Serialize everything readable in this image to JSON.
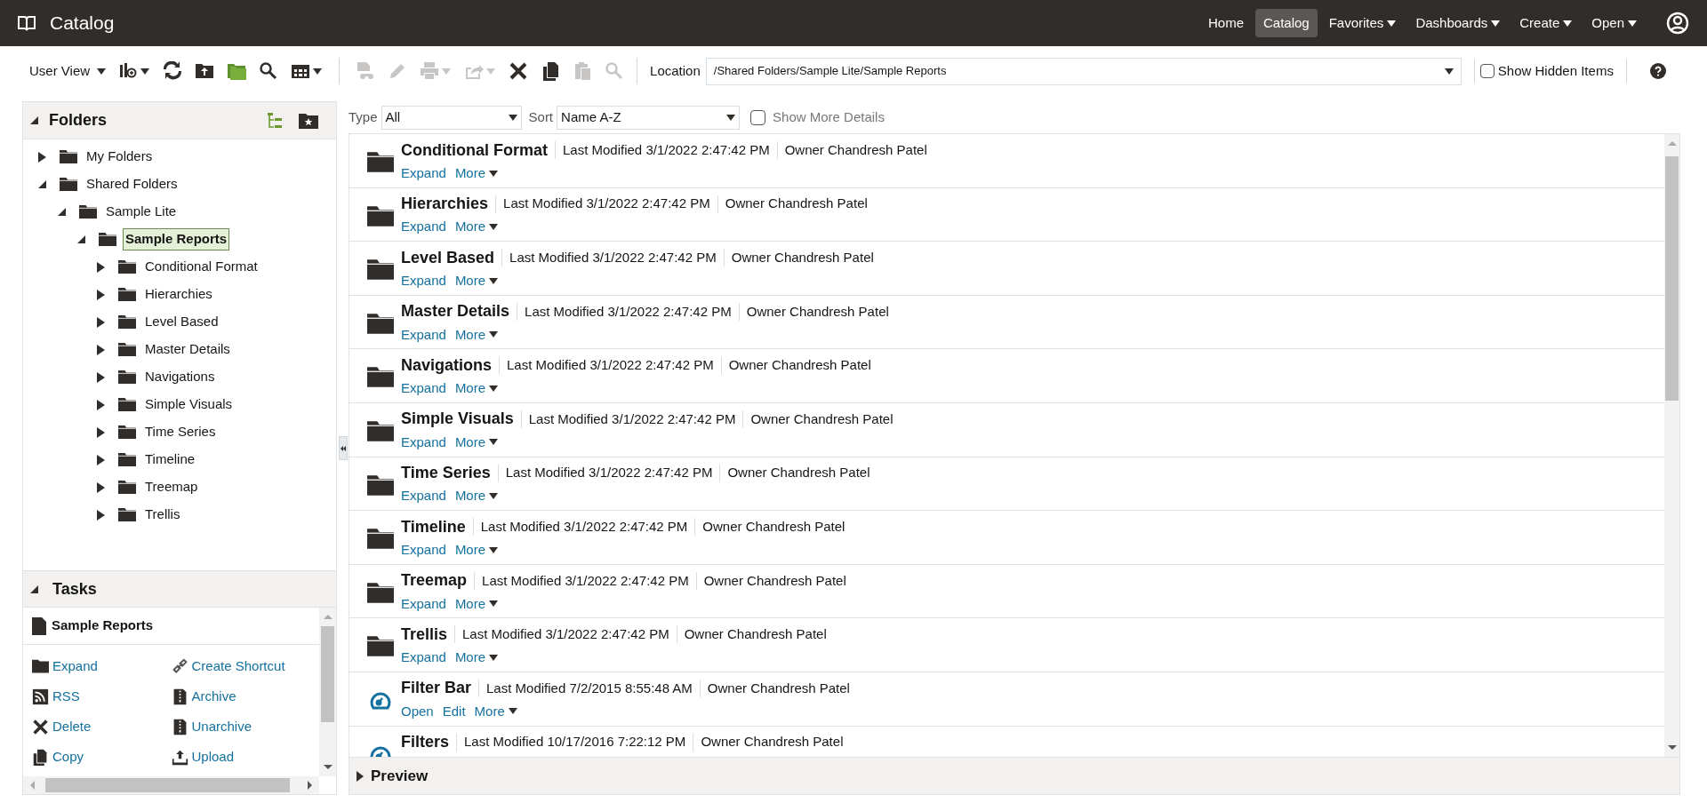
{
  "header": {
    "title": "Catalog",
    "nav": [
      {
        "label": "Home",
        "selected": false,
        "menu": false
      },
      {
        "label": "Catalog",
        "selected": true,
        "menu": false
      },
      {
        "label": "Favorites",
        "selected": false,
        "menu": true
      },
      {
        "label": "Dashboards",
        "selected": false,
        "menu": true
      },
      {
        "label": "Create",
        "selected": false,
        "menu": true
      },
      {
        "label": "Open",
        "selected": false,
        "menu": true
      }
    ]
  },
  "toolbar": {
    "view_menu": "User View",
    "icons": [
      {
        "kind": "new-analysis",
        "disabled": false,
        "menu": true
      },
      {
        "kind": "refresh",
        "disabled": false,
        "menu": false
      },
      {
        "kind": "upload-folder",
        "disabled": false,
        "menu": false
      },
      {
        "kind": "new-folder",
        "disabled": false,
        "menu": false
      },
      {
        "kind": "search",
        "disabled": false,
        "menu": false
      },
      {
        "kind": "grid",
        "disabled": false,
        "menu": true
      },
      {
        "kind": "report",
        "disabled": true,
        "menu": false
      },
      {
        "kind": "edit",
        "disabled": true,
        "menu": false
      },
      {
        "kind": "print",
        "disabled": true,
        "menu": true
      },
      {
        "kind": "share",
        "disabled": true,
        "menu": true
      },
      {
        "kind": "delete",
        "disabled": false,
        "menu": false
      },
      {
        "kind": "copy",
        "disabled": false,
        "menu": false
      },
      {
        "kind": "paste",
        "disabled": true,
        "menu": false
      },
      {
        "kind": "search",
        "disabled": true,
        "menu": false
      }
    ],
    "location_label": "Location",
    "location": "/Shared Folders/Sample Lite/Sample Reports",
    "show_hidden": {
      "label": "Show Hidden Items",
      "checked": false
    }
  },
  "folders": {
    "title": "Folders",
    "tree": [
      {
        "label": "My Folders",
        "expanded": false,
        "selected": false
      },
      {
        "label": "Shared Folders",
        "expanded": true,
        "selected": false,
        "children": [
          {
            "label": "Sample Lite",
            "expanded": true,
            "selected": false,
            "children": [
              {
                "label": "Sample Reports",
                "expanded": true,
                "selected": true,
                "children": [
                  {
                    "label": "Conditional Format",
                    "expanded": false,
                    "selected": false
                  },
                  {
                    "label": "Hierarchies",
                    "expanded": false,
                    "selected": false
                  },
                  {
                    "label": "Level Based",
                    "expanded": false,
                    "selected": false
                  },
                  {
                    "label": "Master Details",
                    "expanded": false,
                    "selected": false
                  },
                  {
                    "label": "Navigations",
                    "expanded": false,
                    "selected": false
                  },
                  {
                    "label": "Simple Visuals",
                    "expanded": false,
                    "selected": false
                  },
                  {
                    "label": "Time Series",
                    "expanded": false,
                    "selected": false
                  },
                  {
                    "label": "Timeline",
                    "expanded": false,
                    "selected": false
                  },
                  {
                    "label": "Treemap",
                    "expanded": false,
                    "selected": false
                  },
                  {
                    "label": "Trellis",
                    "expanded": false,
                    "selected": false
                  }
                ]
              }
            ]
          }
        ]
      }
    ]
  },
  "tasks": {
    "title": "Tasks",
    "selection": "Sample Reports",
    "actions": [
      {
        "kind": "expand",
        "label": "Expand"
      },
      {
        "kind": "shortcut",
        "label": "Create Shortcut"
      },
      {
        "kind": "rss",
        "label": "RSS"
      },
      {
        "kind": "archive",
        "label": "Archive"
      },
      {
        "kind": "delete",
        "label": "Delete"
      },
      {
        "kind": "archive",
        "label": "Unarchive"
      },
      {
        "kind": "copy",
        "label": "Copy"
      },
      {
        "kind": "upload",
        "label": "Upload"
      }
    ]
  },
  "filters": {
    "type_label": "Type",
    "type": "All",
    "sort_label": "Sort",
    "sort": "Name A-Z",
    "more_details": {
      "label": "Show More Details",
      "checked": false
    }
  },
  "items": [
    {
      "kind": "folder",
      "name": "Conditional Format",
      "modified": "Last Modified 3/1/2022 2:47:42 PM",
      "owner": "Owner Chandresh Patel",
      "actions": [
        "Expand"
      ],
      "more": "More"
    },
    {
      "kind": "folder",
      "name": "Hierarchies",
      "modified": "Last Modified 3/1/2022 2:47:42 PM",
      "owner": "Owner Chandresh Patel",
      "actions": [
        "Expand"
      ],
      "more": "More"
    },
    {
      "kind": "folder",
      "name": "Level Based",
      "modified": "Last Modified 3/1/2022 2:47:42 PM",
      "owner": "Owner Chandresh Patel",
      "actions": [
        "Expand"
      ],
      "more": "More"
    },
    {
      "kind": "folder",
      "name": "Master Details",
      "modified": "Last Modified 3/1/2022 2:47:42 PM",
      "owner": "Owner Chandresh Patel",
      "actions": [
        "Expand"
      ],
      "more": "More"
    },
    {
      "kind": "folder",
      "name": "Navigations",
      "modified": "Last Modified 3/1/2022 2:47:42 PM",
      "owner": "Owner Chandresh Patel",
      "actions": [
        "Expand"
      ],
      "more": "More"
    },
    {
      "kind": "folder",
      "name": "Simple Visuals",
      "modified": "Last Modified 3/1/2022 2:47:42 PM",
      "owner": "Owner Chandresh Patel",
      "actions": [
        "Expand"
      ],
      "more": "More"
    },
    {
      "kind": "folder",
      "name": "Time Series",
      "modified": "Last Modified 3/1/2022 2:47:42 PM",
      "owner": "Owner Chandresh Patel",
      "actions": [
        "Expand"
      ],
      "more": "More"
    },
    {
      "kind": "folder",
      "name": "Timeline",
      "modified": "Last Modified 3/1/2022 2:47:42 PM",
      "owner": "Owner Chandresh Patel",
      "actions": [
        "Expand"
      ],
      "more": "More"
    },
    {
      "kind": "folder",
      "name": "Treemap",
      "modified": "Last Modified 3/1/2022 2:47:42 PM",
      "owner": "Owner Chandresh Patel",
      "actions": [
        "Expand"
      ],
      "more": "More"
    },
    {
      "kind": "folder",
      "name": "Trellis",
      "modified": "Last Modified 3/1/2022 2:47:42 PM",
      "owner": "Owner Chandresh Patel",
      "actions": [
        "Expand"
      ],
      "more": "More"
    },
    {
      "kind": "filter",
      "name": "Filter Bar",
      "modified": "Last Modified 7/2/2015 8:55:48 AM",
      "owner": "Owner Chandresh Patel",
      "actions": [
        "Open",
        "Edit"
      ],
      "more": "More"
    },
    {
      "kind": "filter",
      "name": "Filters",
      "modified": "Last Modified 10/17/2016 7:22:12 PM",
      "owner": "Owner Chandresh Patel"
    }
  ],
  "preview": {
    "title": "Preview",
    "expanded": false
  }
}
